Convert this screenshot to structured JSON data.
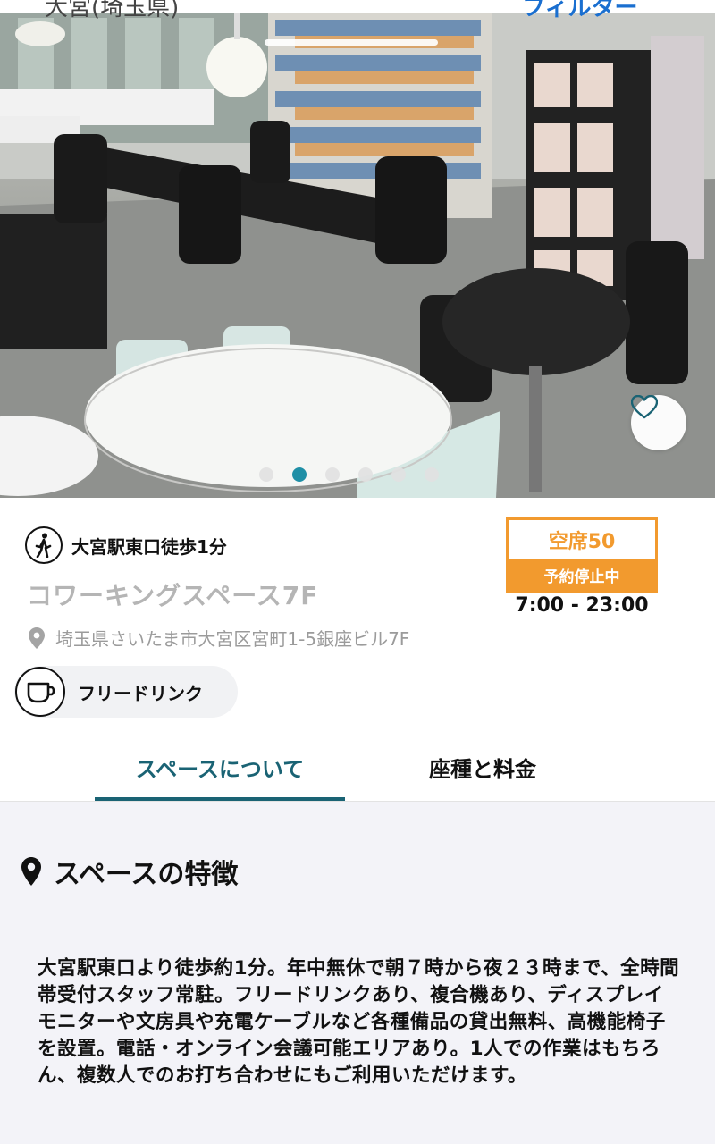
{
  "background": {
    "location_label": "大宮(埼玉県)",
    "filter_label": "フィルター"
  },
  "hero": {
    "image_count": 6,
    "active_index": 1,
    "favorite_icon": "heart-icon"
  },
  "info": {
    "access": "大宮駅東口徒歩1分",
    "name": "コワーキングスペース7F",
    "address": "埼玉県さいたま市大宮区宮町1-5銀座ビル7F",
    "amenity": "フリードリンク",
    "vacancy": {
      "label": "空席50",
      "status": "予約停止中"
    },
    "hours": "7:00 - 23:00"
  },
  "tabs": {
    "about": "スペースについて",
    "pricing": "座種と料金",
    "active": "about"
  },
  "features": {
    "title": "スペースの特徴",
    "body": "大宮駅東口より徒歩約1分。年中無休で朝７時から夜２３時まで、全時間帯受付スタッフ常駐。フリードリンクあり、複合機あり、ディスプレイモニターや文房具や充電ケーブルなど各種備品の貸出無料、高機能椅子を設置。電話・オンライン会議可能エリアあり。1人での作業はもちろん、複数人でのお打ち合わせにもご利用いただけます。"
  },
  "colors": {
    "accent": "#1a6374",
    "vacancy": "#f29a2e",
    "muted_text": "#b5b5b5",
    "dot_active": "#1f8fa6"
  }
}
